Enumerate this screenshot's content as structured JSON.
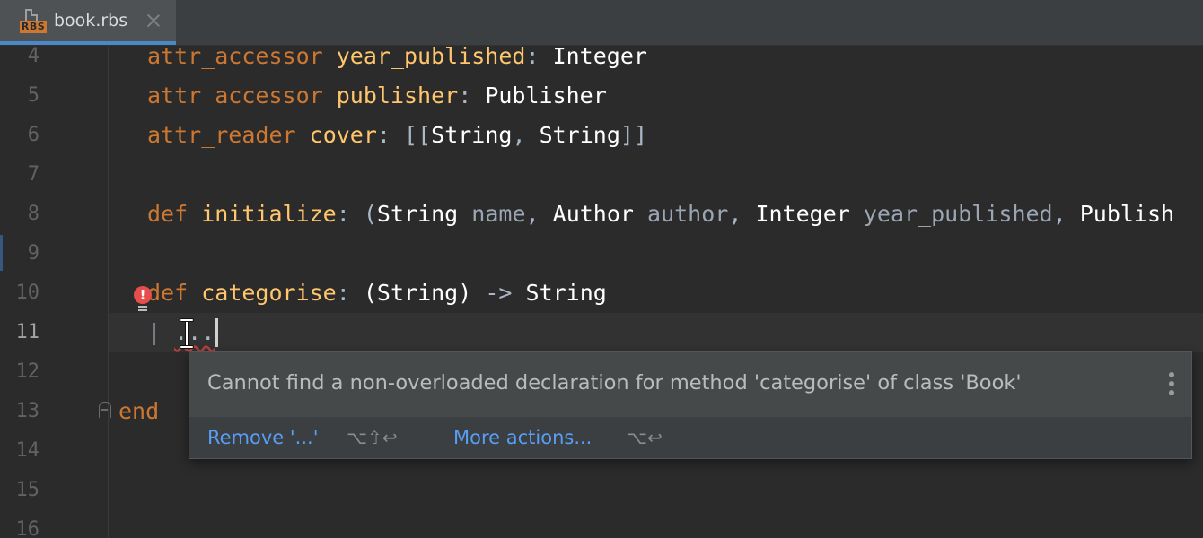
{
  "tab": {
    "title": "book.rbs",
    "icon_badge": "RBS",
    "icon": "rbs-file-icon",
    "close_icon": "close-icon"
  },
  "gutter": {
    "line_numbers": [
      "4",
      "5",
      "6",
      "7",
      "8",
      "9",
      "10",
      "11",
      "12",
      "13",
      "14",
      "15",
      "16"
    ],
    "current_line": "11"
  },
  "code": {
    "line4": {
      "kw": "attr_accessor",
      "name": "year_published",
      "colon": ":",
      "type": "Integer"
    },
    "line5": {
      "kw": "attr_accessor",
      "name": "publisher",
      "colon": ":",
      "type": "Publisher"
    },
    "line6": {
      "kw": "attr_reader",
      "name": "cover",
      "colon": ":",
      "open": "[[",
      "t1": "String",
      "comma": ",",
      "t2": "String",
      "close": "]]"
    },
    "line8": {
      "kw": "def",
      "name": "initialize",
      "colon": ":",
      "open_paren": "(",
      "t1": "String",
      "v1": "name",
      "c1": ",",
      "t2": "Author",
      "v2": "author",
      "c2": ",",
      "t3": "Integer",
      "v3": "year_published",
      "c3": ",",
      "t4": "Publish"
    },
    "line10": {
      "kw": "def",
      "name": "categorise",
      "colon": ":",
      "params": "(String)",
      "arrow": "->",
      "return_type": "String"
    },
    "line11": {
      "pipe": "|",
      "ellipsis": "..."
    },
    "line13": {
      "kw": "end"
    }
  },
  "colors": {
    "keyword": "#cc7832",
    "method_name": "#ffc66d",
    "type": "#ffffff",
    "error": "#e64d4d",
    "link": "#589df6"
  },
  "popup": {
    "message": "Cannot find a non-overloaded declaration for method 'categorise' of class 'Book'",
    "action_primary": "Remove '...'",
    "action_primary_shortcut": "⌥⇧↩",
    "action_more": "More actions...",
    "action_more_shortcut": "⌥↩",
    "menu_icon": "more-vertical-icon"
  },
  "gutter_icons": {
    "error": "error-bulb-icon",
    "error_glyph": "!",
    "fold": "fold-icon"
  }
}
